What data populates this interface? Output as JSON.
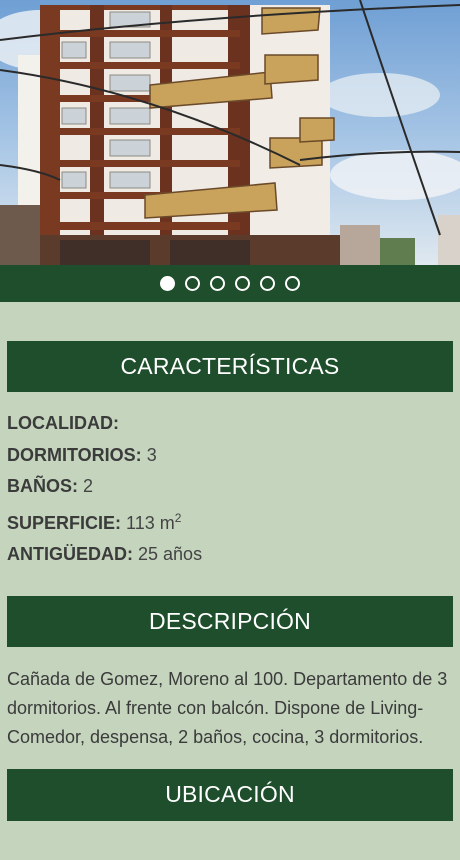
{
  "carousel": {
    "photo_alt": "Edificio de departamentos",
    "slide_count": 6,
    "active_index": 0
  },
  "caracteristicas": {
    "title": "CARACTERÍSTICAS",
    "localidad_label": "LOCALIDAD:",
    "localidad_value": "",
    "dormitorios_label": "DORMITORIOS:",
    "dormitorios_value": "3",
    "banos_label": "BAÑOS:",
    "banos_value": "2",
    "superficie_label": "SUPERFICIE:",
    "superficie_value": "113 m",
    "superficie_exp": "2",
    "antiguedad_label": "ANTIGÜEDAD:",
    "antiguedad_value": "25 años"
  },
  "descripcion": {
    "title": "DESCRIPCIÓN",
    "text": "Cañada de Gomez, Moreno al 100. Departamento de 3 dormitorios. Al frente con balcón. Dispone de Living-Comedor, despensa, 2 baños, cocina, 3 dormitorios."
  },
  "ubicacion": {
    "title": "UBICACIÓN"
  },
  "colors": {
    "header_green": "#1f4e2c",
    "page_background": "#c4d4bd",
    "text": "#3b3b3b"
  }
}
